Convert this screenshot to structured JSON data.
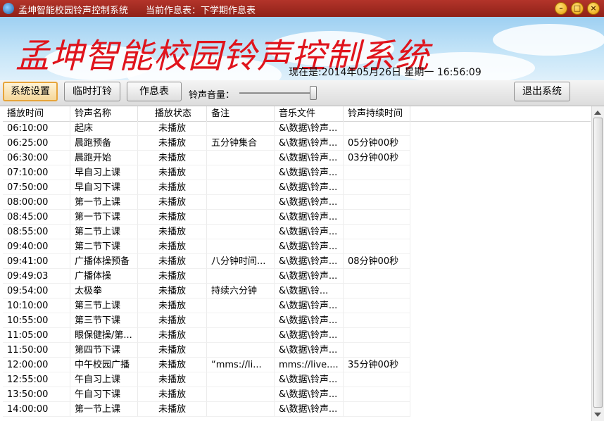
{
  "window": {
    "title": "孟坤智能校园铃声控制系统",
    "schedule_info": "当前作息表：下学期作息表",
    "buttons": [
      "minimize",
      "maximize",
      "close"
    ]
  },
  "banner": {
    "title": "孟坤智能校园铃声控制系统",
    "clock": "现在是:2014年05月26日 星期一 16:56:09"
  },
  "toolbar": {
    "system_settings": "系统设置",
    "temp_ring": "临时打铃",
    "schedule": "作息表",
    "volume_label": "铃声音量：",
    "volume_level": 0.95,
    "exit": "退出系统"
  },
  "table": {
    "columns": [
      "播放时间",
      "铃声名称",
      "播放状态",
      "备注",
      "音乐文件",
      "铃声持续时间"
    ],
    "rows": [
      [
        "06:10:00",
        "起床",
        "未播放",
        "",
        "&\\数据\\铃声...",
        ""
      ],
      [
        "06:25:00",
        "晨跑预备",
        "未播放",
        "五分钟集合",
        "&\\数据\\铃声...",
        "05分钟00秒"
      ],
      [
        "06:30:00",
        "晨跑开始",
        "未播放",
        "",
        "&\\数据\\铃声...",
        "03分钟00秒"
      ],
      [
        "07:10:00",
        "早自习上课",
        "未播放",
        "",
        "&\\数据\\铃声...",
        ""
      ],
      [
        "07:50:00",
        "早自习下课",
        "未播放",
        "",
        "&\\数据\\铃声...",
        ""
      ],
      [
        "08:00:00",
        "第一节上课",
        "未播放",
        "",
        "&\\数据\\铃声...",
        ""
      ],
      [
        "08:45:00",
        "第一节下课",
        "未播放",
        "",
        "&\\数据\\铃声...",
        ""
      ],
      [
        "08:55:00",
        "第二节上课",
        "未播放",
        "",
        "&\\数据\\铃声...",
        ""
      ],
      [
        "09:40:00",
        "第二节下课",
        "未播放",
        "",
        "&\\数据\\铃声...",
        ""
      ],
      [
        "09:41:00",
        "广播体操预备",
        "未播放",
        "八分钟时间...",
        "&\\数据\\铃声...",
        "08分钟00秒"
      ],
      [
        "09:49:03",
        "广播体操",
        "未播放",
        "",
        "&\\数据\\铃声...",
        ""
      ],
      [
        "09:54:00",
        "太极拳",
        "未播放",
        "持续六分钟",
        "&\\数据\\铃...",
        ""
      ],
      [
        "10:10:00",
        "第三节上课",
        "未播放",
        "",
        "&\\数据\\铃声...",
        ""
      ],
      [
        "10:55:00",
        "第三节下课",
        "未播放",
        "",
        "&\\数据\\铃声...",
        ""
      ],
      [
        "11:05:00",
        "眼保健操/第...",
        "未播放",
        "",
        "&\\数据\\铃声...",
        ""
      ],
      [
        "11:50:00",
        "第四节下课",
        "未播放",
        "",
        "&\\数据\\铃声...",
        ""
      ],
      [
        "12:00:00",
        "中午校园广播",
        "未播放",
        "“mms://li...",
        "mms://live....",
        "35分钟00秒"
      ],
      [
        "12:55:00",
        "午自习上课",
        "未播放",
        "",
        "&\\数据\\铃声...",
        ""
      ],
      [
        "13:50:00",
        "午自习下课",
        "未播放",
        "",
        "&\\数据\\铃声...",
        ""
      ],
      [
        "14:00:00",
        "第一节上课",
        "未播放",
        "",
        "&\\数据\\铃声...",
        ""
      ]
    ]
  }
}
